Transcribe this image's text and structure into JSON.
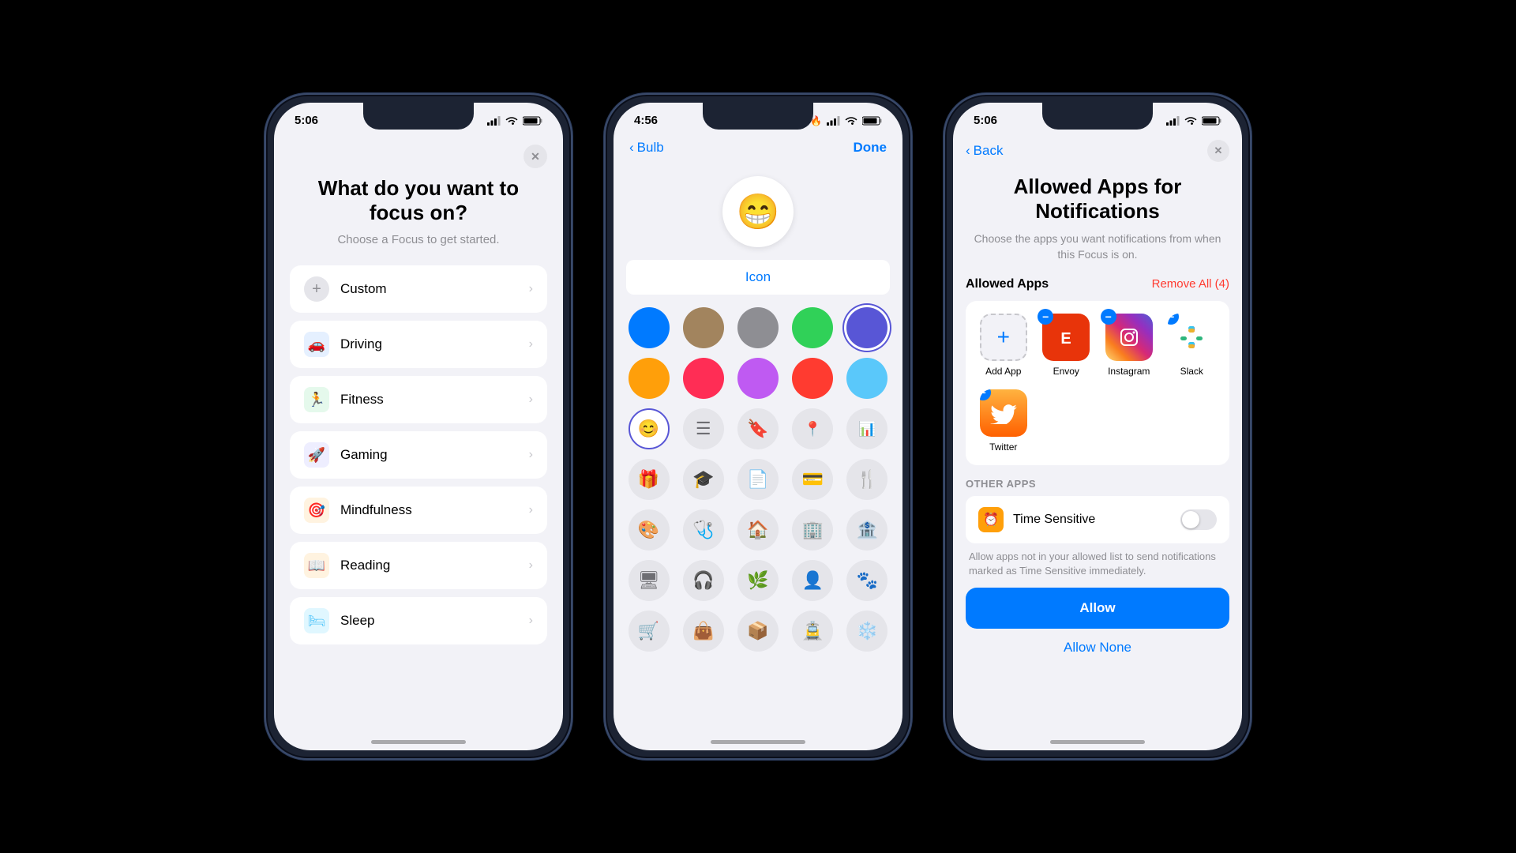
{
  "phone1": {
    "status": {
      "time": "5:06",
      "icons": [
        "signal",
        "wifi",
        "battery"
      ]
    },
    "title": "What do you want to focus on?",
    "subtitle": "Choose a Focus to get started.",
    "items": [
      {
        "id": "custom",
        "label": "Custom",
        "icon": "plus",
        "iconBg": "#e5e5ea"
      },
      {
        "id": "driving",
        "label": "Driving",
        "icon": "🚗",
        "iconBg": "#007aff"
      },
      {
        "id": "fitness",
        "label": "Fitness",
        "icon": "🏃",
        "iconBg": "#30d158"
      },
      {
        "id": "gaming",
        "label": "Gaming",
        "icon": "🚀",
        "iconBg": "#5856d6"
      },
      {
        "id": "mindfulness",
        "label": "Mindfulness",
        "icon": "🎯",
        "iconBg": "#ff9f0a"
      },
      {
        "id": "reading",
        "label": "Reading",
        "icon": "📖",
        "iconBg": "#ff9f0a"
      },
      {
        "id": "sleep",
        "label": "Sleep",
        "icon": "🛏",
        "iconBg": "#5ac8fa"
      }
    ]
  },
  "phone2": {
    "status": {
      "time": "4:56",
      "icons": [
        "flame",
        "signal",
        "wifi",
        "battery"
      ]
    },
    "nav": {
      "back": "Bulb",
      "done": "Done"
    },
    "selectedEmoji": "😁",
    "tabLabel": "Icon",
    "colors": [
      {
        "id": "blue",
        "hex": "#007aff",
        "selected": false
      },
      {
        "id": "brown",
        "hex": "#a2845e",
        "selected": false
      },
      {
        "id": "gray",
        "hex": "#8e8e93",
        "selected": false
      },
      {
        "id": "green",
        "hex": "#30d158",
        "selected": false
      },
      {
        "id": "purple-dark",
        "hex": "#5856d6",
        "selected": true
      },
      {
        "id": "orange",
        "hex": "#ff9f0a",
        "selected": false
      },
      {
        "id": "red",
        "hex": "#ff2d55",
        "selected": false
      },
      {
        "id": "purple",
        "hex": "#bf5af2",
        "selected": false
      },
      {
        "id": "red2",
        "hex": "#ff3b30",
        "selected": false
      },
      {
        "id": "teal",
        "hex": "#5ac8fa",
        "selected": false
      }
    ],
    "symbols": [
      {
        "id": "smiley",
        "icon": "😊",
        "selected": true
      },
      {
        "id": "list",
        "icon": "☰"
      },
      {
        "id": "bookmark",
        "icon": "🔖"
      },
      {
        "id": "pin",
        "icon": "📍"
      },
      {
        "id": "chart",
        "icon": "📊"
      },
      {
        "id": "gift",
        "icon": "🎁"
      },
      {
        "id": "grad",
        "icon": "🎓"
      },
      {
        "id": "doc",
        "icon": "📄"
      },
      {
        "id": "card",
        "icon": "💳"
      },
      {
        "id": "fork",
        "icon": "🍴"
      },
      {
        "id": "paint",
        "icon": "🎨"
      },
      {
        "id": "health",
        "icon": "🩺"
      },
      {
        "id": "home",
        "icon": "🏠"
      },
      {
        "id": "building",
        "icon": "🏢"
      },
      {
        "id": "bank",
        "icon": "🏦"
      },
      {
        "id": "monitor",
        "icon": "🖥"
      },
      {
        "id": "headphones",
        "icon": "🎧"
      },
      {
        "id": "leaf",
        "icon": "🌿"
      },
      {
        "id": "person",
        "icon": "👤"
      },
      {
        "id": "paw",
        "icon": "🐾"
      },
      {
        "id": "cart",
        "icon": "🛒"
      },
      {
        "id": "bag",
        "icon": "👜"
      },
      {
        "id": "box",
        "icon": "📦"
      },
      {
        "id": "train",
        "icon": "🚊"
      },
      {
        "id": "snowflake",
        "icon": "❄️"
      }
    ]
  },
  "phone3": {
    "status": {
      "time": "5:06",
      "icons": [
        "signal",
        "wifi",
        "battery"
      ]
    },
    "nav": {
      "back": "Back"
    },
    "title": "Allowed Apps for Notifications",
    "subtitle": "Choose the apps you want notifications from when this Focus is on.",
    "allowedApps": {
      "label": "Allowed Apps",
      "removeAll": "Remove All (4)",
      "apps": [
        {
          "id": "add",
          "label": "Add App",
          "type": "add"
        },
        {
          "id": "envoy",
          "label": "Envoy",
          "type": "envoy"
        },
        {
          "id": "instagram",
          "label": "Instagram",
          "type": "instagram"
        },
        {
          "id": "slack",
          "label": "Slack",
          "type": "slack"
        },
        {
          "id": "twitter",
          "label": "Twitter",
          "type": "twitter"
        }
      ]
    },
    "otherApps": {
      "label": "OTHER APPS",
      "timeSensitive": {
        "label": "Time Sensitive",
        "description": "Allow apps not in your allowed list to send notifications marked as Time Sensitive immediately.",
        "enabled": false
      }
    },
    "allowBtn": "Allow",
    "allowNoneBtn": "Allow None"
  }
}
